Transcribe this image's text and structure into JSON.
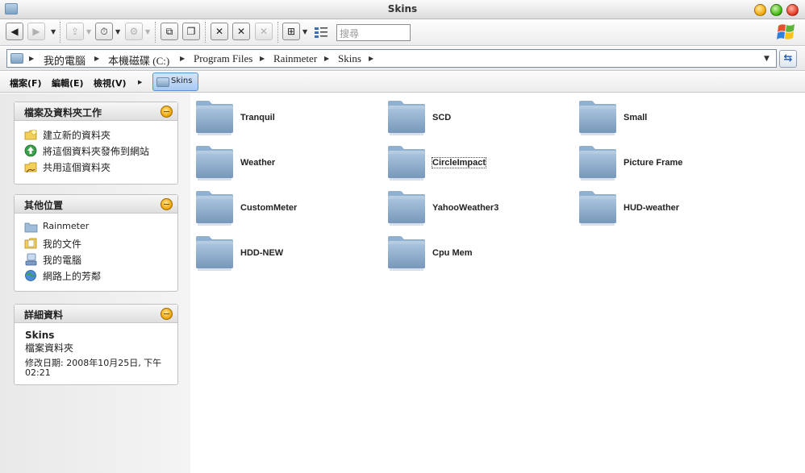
{
  "window": {
    "title": "Skins"
  },
  "toolbar": {
    "search_placeholder": "搜尋"
  },
  "address": {
    "crumbs": [
      "我的電腦",
      "本機磁碟 (C:)",
      "Program Files",
      "Rainmeter",
      "Skins"
    ]
  },
  "menu": {
    "items": [
      "檔案(F)",
      "編輯(E)",
      "檢視(V)"
    ],
    "current_folder": "Skins"
  },
  "panels": {
    "tasks": {
      "title": "檔案及資料夾工作",
      "items": [
        {
          "label": "建立新的資料夾",
          "icon": "new-folder-icon"
        },
        {
          "label": "將這個資料夾發佈到網站",
          "icon": "publish-web-icon"
        },
        {
          "label": "共用這個資料夾",
          "icon": "share-folder-icon"
        }
      ]
    },
    "places": {
      "title": "其他位置",
      "items": [
        {
          "label": "Rainmeter",
          "icon": "folder-icon"
        },
        {
          "label": "我的文件",
          "icon": "my-documents-icon"
        },
        {
          "label": "我的電腦",
          "icon": "my-computer-icon"
        },
        {
          "label": "網路上的芳鄰",
          "icon": "network-places-icon"
        }
      ]
    },
    "details": {
      "title": "詳細資料",
      "name": "Skins",
      "type": "檔案資料夾",
      "modified_line1": "修改日期: 2008年10月25日, 下午",
      "modified_line2": "02:21"
    }
  },
  "folders": [
    {
      "name": "Tranquil"
    },
    {
      "name": "SCD"
    },
    {
      "name": "Small"
    },
    {
      "name": "Weather"
    },
    {
      "name": "CircleImpact",
      "focused": true
    },
    {
      "name": "Picture Frame"
    },
    {
      "name": "CustomMeter"
    },
    {
      "name": "YahooWeather3"
    },
    {
      "name": "HUD-weather"
    },
    {
      "name": "HDD-NEW"
    },
    {
      "name": "Cpu Mem"
    }
  ]
}
